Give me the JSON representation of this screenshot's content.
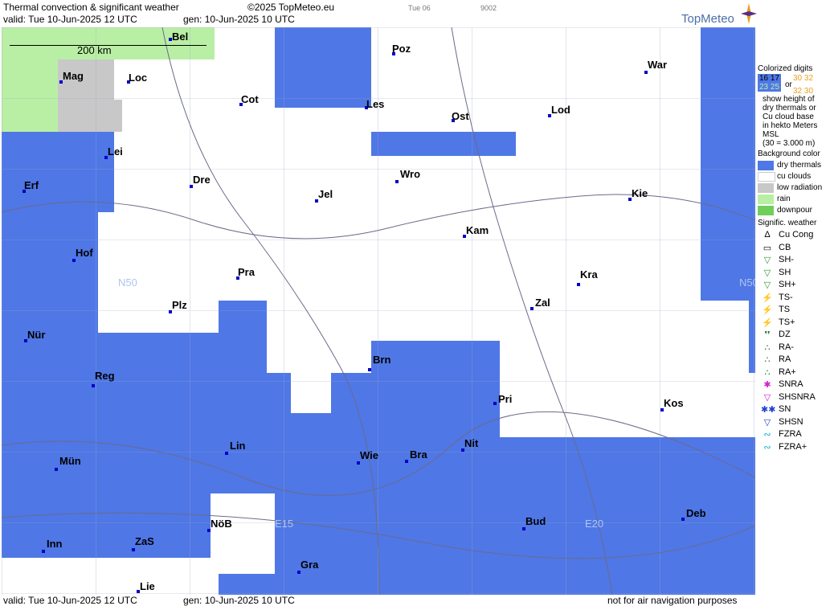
{
  "header": {
    "title": "Thermal convection & significant weather",
    "copyright": "©2025 TopMeteo.eu",
    "valid": "valid:  Tue  10-Jun-2025  12 UTC",
    "gen": "gen: 10-Jun-2025 10 UTC",
    "code1": "Tue 06",
    "code2": "9002",
    "logo": "TopMeteo"
  },
  "scale_label": "200 km",
  "cities": [
    {
      "name": "Bel"
    },
    {
      "name": "Poz"
    },
    {
      "name": "War"
    },
    {
      "name": "Mag"
    },
    {
      "name": "Loc"
    },
    {
      "name": "Cot"
    },
    {
      "name": "Les"
    },
    {
      "name": "Ost"
    },
    {
      "name": "Lod"
    },
    {
      "name": "Lei"
    },
    {
      "name": "Dre"
    },
    {
      "name": "Wro"
    },
    {
      "name": "Erf"
    },
    {
      "name": "Jel"
    },
    {
      "name": "Kie"
    },
    {
      "name": "Kam"
    },
    {
      "name": "Hof"
    },
    {
      "name": "Pra"
    },
    {
      "name": "Kra"
    },
    {
      "name": "Plz"
    },
    {
      "name": "Zal"
    },
    {
      "name": "Nür"
    },
    {
      "name": "Brn"
    },
    {
      "name": "Reg"
    },
    {
      "name": "Pri"
    },
    {
      "name": "Kos"
    },
    {
      "name": "Lin"
    },
    {
      "name": "Nit"
    },
    {
      "name": "Mün"
    },
    {
      "name": "Wie"
    },
    {
      "name": "Bra"
    },
    {
      "name": "NöB"
    },
    {
      "name": "Deb"
    },
    {
      "name": "Bud"
    },
    {
      "name": "ZaS"
    },
    {
      "name": "Inn"
    },
    {
      "name": "Gra"
    },
    {
      "name": "Lie"
    }
  ],
  "grid_labels": [
    "N50",
    "N50",
    "E15",
    "E20"
  ],
  "legend": {
    "colorized_title": "Colorized digits",
    "sample_a": "16 17",
    "sample_b": "23 25",
    "sample_or": "or",
    "sample_c": "30 32",
    "sample_d": "32 30",
    "desc1": "show height of",
    "desc2": "dry thermals or",
    "desc3": "Cu cloud base",
    "desc4": "in hekto Meters",
    "desc5": "MSL",
    "desc6": "(30 = 3.000 m)",
    "bg_title": "Background color",
    "bg_items": [
      {
        "label": "dry thermals",
        "color": "#4f77e6"
      },
      {
        "label": "cu clouds",
        "color": "#ffffff"
      },
      {
        "label": "low radiation",
        "color": "#c8c8c8"
      },
      {
        "label": "rain",
        "color": "#b9efa4"
      },
      {
        "label": "downpour",
        "color": "#6fcf5a"
      }
    ],
    "sig_title": "Signific. weather",
    "sig_items": [
      {
        "icon": "Δ",
        "label": "Cu Cong",
        "color": "#000000"
      },
      {
        "icon": "▭",
        "label": "CB",
        "color": "#000000"
      },
      {
        "icon": "▽",
        "label": "SH-",
        "color": "#2a9a2a"
      },
      {
        "icon": "▽",
        "label": "SH",
        "color": "#2a9a2a"
      },
      {
        "icon": "▽",
        "label": "SH+",
        "color": "#2a9a2a"
      },
      {
        "icon": "⚡",
        "label": "TS-",
        "color": "#d01010"
      },
      {
        "icon": "⚡",
        "label": "TS",
        "color": "#d01010"
      },
      {
        "icon": "⚡",
        "label": "TS+",
        "color": "#d01010"
      },
      {
        "icon": "❜❜",
        "label": "DZ",
        "color": "#1a6a1a"
      },
      {
        "icon": "∴",
        "label": "RA-",
        "color": "#1a6a1a"
      },
      {
        "icon": "∴",
        "label": "RA",
        "color": "#1a6a1a"
      },
      {
        "icon": "∴",
        "label": "RA+",
        "color": "#1a6a1a"
      },
      {
        "icon": "✱",
        "label": "SNRA",
        "color": "#d020d0"
      },
      {
        "icon": "▽",
        "label": "SHSNRA",
        "color": "#d020d0"
      },
      {
        "icon": "✱✱",
        "label": "SN",
        "color": "#2040d0"
      },
      {
        "icon": "▽",
        "label": "SHSN",
        "color": "#2040d0"
      },
      {
        "icon": "∾",
        "label": "FZRA",
        "color": "#10b0d0"
      },
      {
        "icon": "∾",
        "label": "FZRA+",
        "color": "#10b0d0"
      }
    ]
  },
  "footer": {
    "valid": "valid:  Tue  10-Jun-2025  12 UTC",
    "gen": "gen: 10-Jun-2025 10 UTC",
    "note": "not for air navigation purposes"
  }
}
